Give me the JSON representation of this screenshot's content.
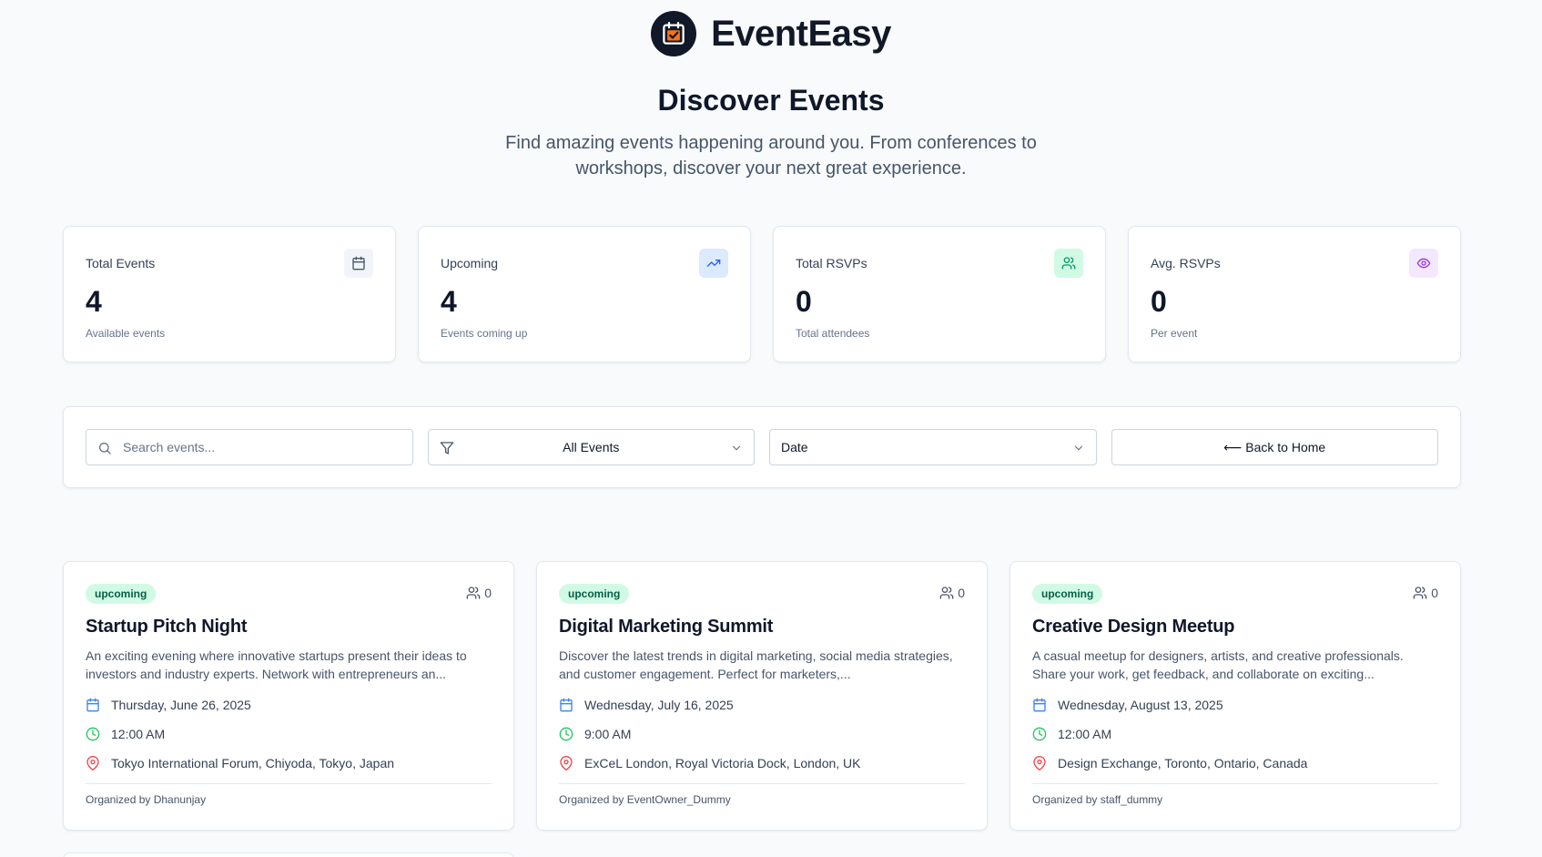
{
  "brand": {
    "name": "EventEasy"
  },
  "page": {
    "title": "Discover Events",
    "subtitle": "Find amazing events happening around you. From conferences to workshops, discover your next great experience."
  },
  "stats": [
    {
      "label": "Total Events",
      "value": "4",
      "caption": "Available events",
      "icon": "calendar-icon",
      "icon_bg": "#f1f5f9",
      "icon_color": "#475569"
    },
    {
      "label": "Upcoming",
      "value": "4",
      "caption": "Events coming up",
      "icon": "trending-up-icon",
      "icon_bg": "#dbeafe",
      "icon_color": "#2563eb"
    },
    {
      "label": "Total RSVPs",
      "value": "0",
      "caption": "Total attendees",
      "icon": "users-icon",
      "icon_bg": "#d1fae5",
      "icon_color": "#059669"
    },
    {
      "label": "Avg. RSVPs",
      "value": "0",
      "caption": "Per event",
      "icon": "eye-icon",
      "icon_bg": "#f3e8ff",
      "icon_color": "#9333ea"
    }
  ],
  "filters": {
    "search_placeholder": "Search events...",
    "status_selected": "All Events",
    "sort_selected": "Date",
    "back_label": "⟵ Back to Home"
  },
  "events": [
    {
      "status": "upcoming",
      "rsvps": "0",
      "title": "Startup Pitch Night",
      "description": "An exciting evening where innovative startups present their ideas to investors and industry experts. Network with entrepreneurs an...",
      "date": "Thursday, June 26, 2025",
      "time": "12:00 AM",
      "location": "Tokyo International Forum, Chiyoda, Tokyo, Japan",
      "organizer": "Organized by Dhanunjay"
    },
    {
      "status": "upcoming",
      "rsvps": "0",
      "title": "Digital Marketing Summit",
      "description": "Discover the latest trends in digital marketing, social media strategies, and customer engagement. Perfect for marketers,...",
      "date": "Wednesday, July 16, 2025",
      "time": "9:00 AM",
      "location": "ExCeL London, Royal Victoria Dock, London, UK",
      "organizer": "Organized by EventOwner_Dummy"
    },
    {
      "status": "upcoming",
      "rsvps": "0",
      "title": "Creative Design Meetup",
      "description": "A casual meetup for designers, artists, and creative professionals. Share your work, get feedback, and collaborate on exciting...",
      "date": "Wednesday, August 13, 2025",
      "time": "12:00 AM",
      "location": "Design Exchange, Toronto, Ontario, Canada",
      "organizer": "Organized by staff_dummy"
    }
  ],
  "colors": {
    "brand_dark": "#111827",
    "brand_accent": "#f97316",
    "badge_bg": "#d1fae5",
    "badge_text": "#065f46",
    "date_icon": "#3b82f6",
    "time_icon": "#22c55e",
    "location_icon": "#ef4444"
  }
}
